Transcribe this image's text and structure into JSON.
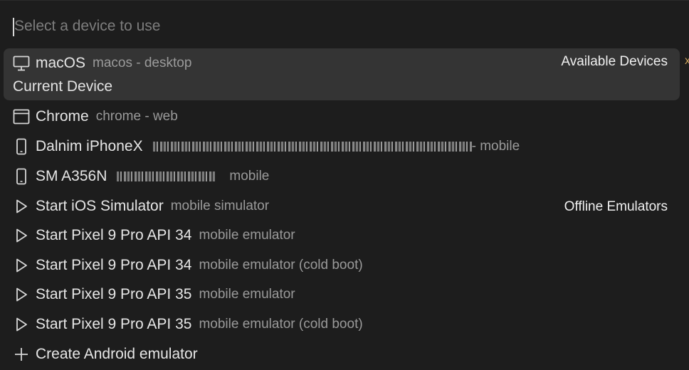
{
  "search": {
    "placeholder": "Select a device to use",
    "value": ""
  },
  "groups": {
    "available": "Available Devices",
    "offline": "Offline Emulators"
  },
  "items": [
    {
      "icon": "monitor-icon",
      "label": "macOS",
      "desc": "macos - desktop",
      "sub": "Current Device",
      "selected": true
    },
    {
      "icon": "browser-window-icon",
      "label": "Chrome",
      "desc": "chrome - web"
    },
    {
      "icon": "phone-icon",
      "label": "Dalnim iPhoneX",
      "desc": "- mobile"
    },
    {
      "icon": "phone-icon",
      "label": "SM A356N",
      "desc": "mobile"
    },
    {
      "icon": "play-icon",
      "label": "Start iOS Simulator",
      "desc": "mobile simulator"
    },
    {
      "icon": "play-icon",
      "label": "Start Pixel 9 Pro API 34",
      "desc": "mobile emulator"
    },
    {
      "icon": "play-icon",
      "label": "Start Pixel 9 Pro API 34",
      "desc": "mobile emulator (cold boot)"
    },
    {
      "icon": "play-icon",
      "label": "Start Pixel 9 Pro API 35",
      "desc": "mobile emulator"
    },
    {
      "icon": "play-icon",
      "label": "Start Pixel 9 Pro API 35",
      "desc": "mobile emulator (cold boot)"
    },
    {
      "icon": "plus-icon",
      "label": "Create Android emulator",
      "desc": ""
    }
  ],
  "edge_mark": "x",
  "colors": {
    "background": "#1d1d1d",
    "selected": "#343434",
    "text": "#e6e6e6",
    "muted": "#9a9a9a"
  }
}
